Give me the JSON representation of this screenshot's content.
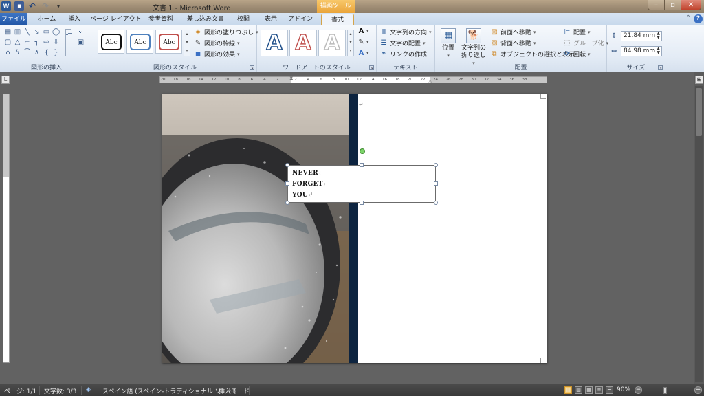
{
  "window": {
    "title": "文書 1 - Microsoft Word",
    "contextual_tab_group": "描画ツール"
  },
  "tabs": [
    "ファイル",
    "ホーム",
    "挿入",
    "ページ レイアウト",
    "参考資料",
    "差し込み文書",
    "校閲",
    "表示",
    "アドイン",
    "書式"
  ],
  "active_tab": "書式",
  "ribbon": {
    "groups": {
      "insert_shapes": "図形の挿入",
      "shape_styles": "図形のスタイル",
      "wordart_styles": "ワードアートのスタイル",
      "text": "テキスト",
      "arrange": "配置",
      "size": "サイズ"
    },
    "shape_styles": {
      "samples": [
        "Abc",
        "Abc",
        "Abc"
      ],
      "fill": "図形の塗りつぶし",
      "outline": "図形の枠線",
      "effects": "図形の効果"
    },
    "wordart": {
      "samples": [
        "A",
        "A",
        "A"
      ]
    },
    "text": {
      "direction": "文字列の方向",
      "align": "文字の配置",
      "link": "リンクの作成"
    },
    "arrange": {
      "position": "位置",
      "wrap_line1": "文字列の",
      "wrap_line2": "折り返し",
      "bring_forward": "前面へ移動",
      "send_backward": "背面へ移動",
      "selection_pane": "オブジェクトの選択と表示",
      "align": "配置",
      "group": "グループ化",
      "rotate": "回転"
    },
    "size": {
      "height": "21.84 mm",
      "width": "84.98 mm"
    }
  },
  "ruler": {
    "ticks": [
      "20",
      "18",
      "16",
      "14",
      "12",
      "10",
      "8",
      "6",
      "4",
      "2",
      "2",
      "4",
      "6",
      "8",
      "10",
      "12",
      "14",
      "16",
      "18",
      "20",
      "22",
      "24",
      "26",
      "28",
      "30",
      "32",
      "34",
      "36",
      "38"
    ]
  },
  "document": {
    "textbox_lines": [
      "NEVER",
      "FORGET",
      "YOU"
    ],
    "paragraph_mark": "↵"
  },
  "statusbar": {
    "page": "ページ: 1/1",
    "word_count": "文字数: 3/3",
    "language": "スペイン語 (スペイン-トラディショナル ソート)",
    "mode": "挿入モード",
    "zoom": "90%"
  },
  "colors": {
    "accent": "#2b5797",
    "contextual": "#eaa43a",
    "dark_strip": "#0d2440"
  }
}
